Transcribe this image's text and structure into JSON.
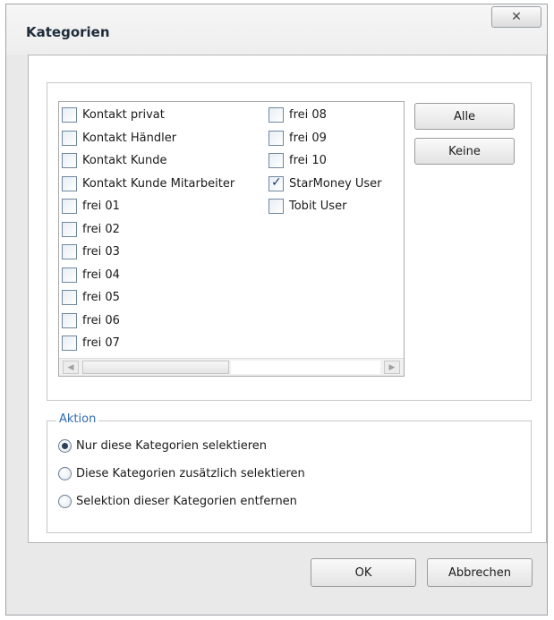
{
  "window": {
    "title": "Kategorien",
    "close_glyph": "✕"
  },
  "categories": {
    "column1": [
      {
        "label": "Kontakt privat",
        "checked": false
      },
      {
        "label": "Kontakt Händler",
        "checked": false
      },
      {
        "label": "Kontakt Kunde",
        "checked": false
      },
      {
        "label": "Kontakt Kunde Mitarbeiter",
        "checked": false
      },
      {
        "label": "frei 01",
        "checked": false
      },
      {
        "label": "frei 02",
        "checked": false
      },
      {
        "label": "frei 03",
        "checked": false
      },
      {
        "label": "frei 04",
        "checked": false
      },
      {
        "label": "frei 05",
        "checked": false
      },
      {
        "label": "frei 06",
        "checked": false
      },
      {
        "label": "frei 07",
        "checked": false
      }
    ],
    "column2": [
      {
        "label": "frei 08",
        "checked": false
      },
      {
        "label": "frei 09",
        "checked": false
      },
      {
        "label": "frei 10",
        "checked": false
      },
      {
        "label": "StarMoney User",
        "checked": true
      },
      {
        "label": "Tobit User",
        "checked": false
      }
    ]
  },
  "buttons": {
    "all": "Alle",
    "none": "Keine",
    "ok": "OK",
    "cancel": "Abbrechen"
  },
  "aktion": {
    "legend": "Aktion",
    "options": [
      {
        "label": "Nur diese Kategorien selektieren",
        "selected": true
      },
      {
        "label": "Diese Kategorien zusätzlich selektieren",
        "selected": false
      },
      {
        "label": "Selektion dieser Kategorien entfernen",
        "selected": false
      }
    ]
  },
  "scrollbar": {
    "left_arrow": "◀",
    "right_arrow": "▶"
  }
}
